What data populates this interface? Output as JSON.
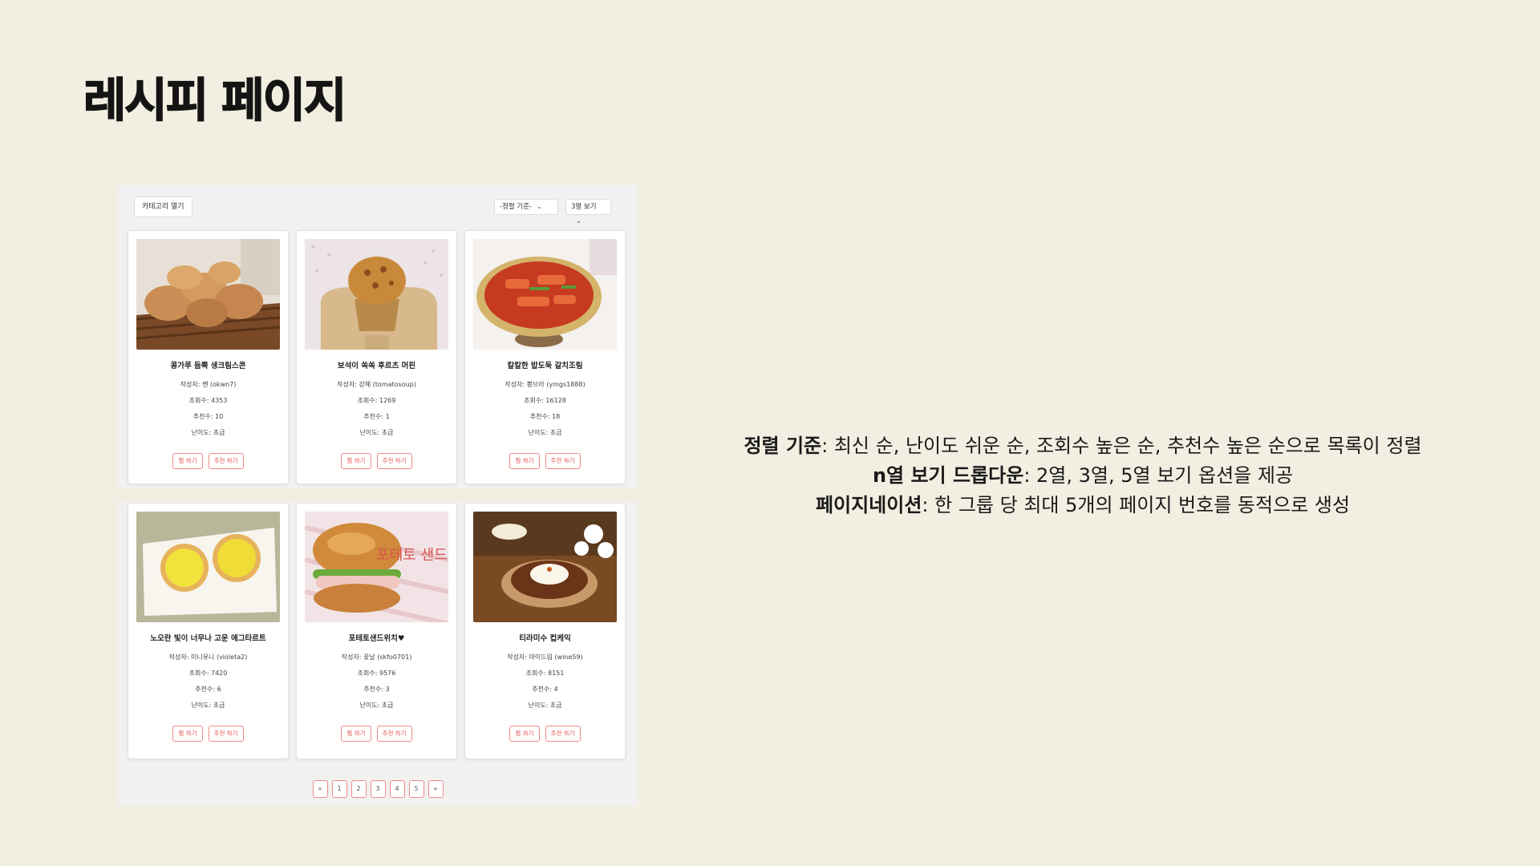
{
  "slide": {
    "title": "레시피 페이지"
  },
  "toolbar": {
    "category_button": "카테고리 열기",
    "sort_select": "-정렬 기준-",
    "view_select": "3열 보기"
  },
  "cards": [
    {
      "title": "콩가루 듬뿍 생크림스콘",
      "author": "작성자: 쏀 (okwn7)",
      "views": "조회수: 4353",
      "likes": "추천수: 10",
      "difficulty": "난이도: 초급",
      "btn_save": "찜 하기",
      "btn_recommend": "추천 하기"
    },
    {
      "title": "보석이 쏙쏙 후르츠 머핀",
      "author": "작성자: 강혜 (tomatosoup)",
      "views": "조회수: 1269",
      "likes": "추천수: 1",
      "difficulty": "난이도: 초급",
      "btn_save": "찜 하기",
      "btn_recommend": "추천 하기"
    },
    {
      "title": "칼칼한 밥도둑 갈치조림",
      "author": "작성자: 뽕브라 (ymgs1888)",
      "views": "조회수: 16128",
      "likes": "추천수: 18",
      "difficulty": "난이도: 초급",
      "btn_save": "찜 하기",
      "btn_recommend": "추천 하기"
    },
    {
      "title": "노오란 빛이 너무나 고운 에그타르트",
      "author": "작성자: 미니유니 (violeta2)",
      "views": "조회수: 7420",
      "likes": "추천수: 6",
      "difficulty": "난이도: 초급",
      "btn_save": "찜 하기",
      "btn_recommend": "추천 하기"
    },
    {
      "title": "포테토샌드위치♥",
      "author": "작성자: 꽃날 (skfo0701)",
      "views": "조회수: 9576",
      "likes": "추천수: 3",
      "difficulty": "난이도: 초급",
      "btn_save": "찜 하기",
      "btn_recommend": "추천 하기"
    },
    {
      "title": "티라미수 컵케익",
      "author": "작성자: 마이드림 (wine59)",
      "views": "조회수: 8151",
      "likes": "추천수: 4",
      "difficulty": "난이도: 초급",
      "btn_save": "찜 하기",
      "btn_recommend": "추천 하기"
    }
  ],
  "thumb_text": {
    "card5": "포테토 샌드위치"
  },
  "pagination": {
    "prev": "«",
    "pages": [
      "1",
      "2",
      "3",
      "4",
      "5"
    ],
    "next": "»"
  },
  "description": [
    {
      "label": "정렬 기준",
      "text": ": 최신 순, 난이도 쉬운 순, 조회수 높은 순, 추천수 높은 순으로 목록이 정렬"
    },
    {
      "label": "n열 보기 드롭다운",
      "text": ": 2열, 3열, 5열 보기 옵션을 제공"
    },
    {
      "label": "페이지네이션",
      "text": ": 한 그룹 당 최대 5개의 페이지 번호를 동적으로 생성"
    }
  ]
}
